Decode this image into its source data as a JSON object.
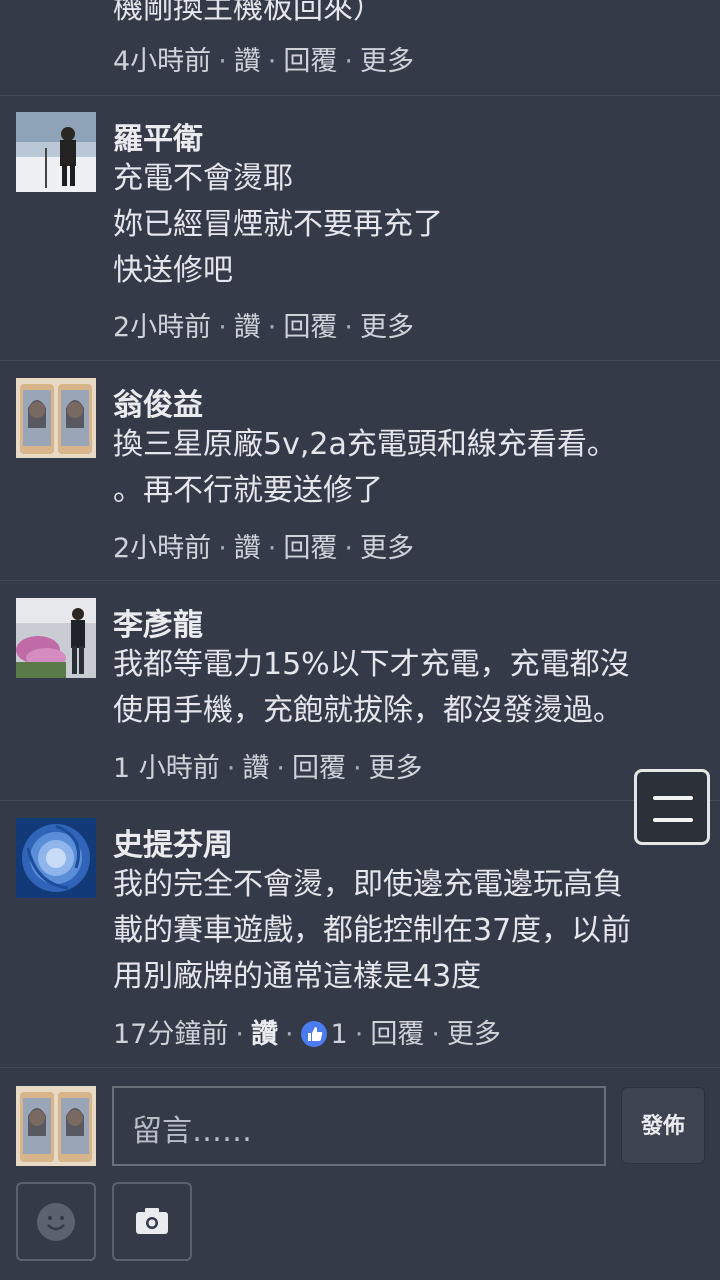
{
  "comments": [
    {
      "name": "",
      "body": "機剛換主機板回來）",
      "time": "4小時前",
      "like": "讚",
      "reply": "回覆",
      "more": "更多"
    },
    {
      "name": "羅平衛",
      "body": "充電不會燙耶\n妳已經冒煙就不要再充了\n快送修吧",
      "time": "2小時前",
      "like": "讚",
      "reply": "回覆",
      "more": "更多"
    },
    {
      "name": "翁俊益",
      "body": "換三星原廠5v,2a充電頭和線充看看。\n。再不行就要送修了",
      "time": "2小時前",
      "like": "讚",
      "reply": "回覆",
      "more": "更多"
    },
    {
      "name": "李彥龍",
      "body": "我都等電力15%以下才充電，充電都沒\n使用手機，充飽就拔除，都沒發燙過。",
      "time": "1 小時前",
      "like": "讚",
      "reply": "回覆",
      "more": "更多"
    },
    {
      "name": "史提芬周",
      "body": "我的完全不會燙，即使邊充電邊玩高負\n載的賽車遊戲，都能控制在37度，以前\n用別廠牌的通常這樣是43度",
      "time": "17分鐘前",
      "like": "讚",
      "like_count": "1",
      "reply": "回覆",
      "more": "更多"
    }
  ],
  "composer": {
    "placeholder": "留言……",
    "post_label": "發佈"
  },
  "icons": {
    "menu": "menu-icon",
    "emoji": "emoji-icon",
    "camera": "camera-icon",
    "like_badge": "thumbs-up-icon"
  },
  "colors": {
    "background": "#353a48",
    "like_badge": "#4a7cf0"
  }
}
